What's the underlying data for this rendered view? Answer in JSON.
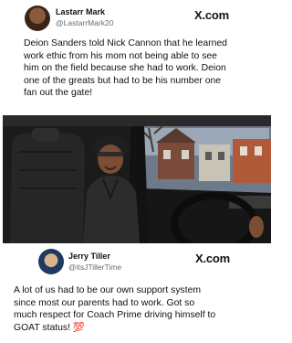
{
  "post1": {
    "name": "Lastarr Mark",
    "handle": "@LastarrMark20",
    "platform": "X.com",
    "text_lines": [
      "Deion Sanders told Nick Cannon that he learned",
      "work ethic from his mom not being able to see",
      "him on the field because she had to work. Deion",
      "one of the greats but had to be his number one",
      "fan out the gate!"
    ]
  },
  "post2": {
    "name": "Jerry Tiller",
    "handle": "@itsJTillerTime",
    "platform": "X.com",
    "text_lines": [
      "A lot of us had to be our own support system",
      "since most our parents had to work. Got so",
      "much respect for Coach Prime driving himself to",
      "GOAT status! 💯"
    ]
  },
  "colors": {
    "text": "#111111",
    "handle": "#6b6b6b",
    "background": "#ffffff"
  }
}
